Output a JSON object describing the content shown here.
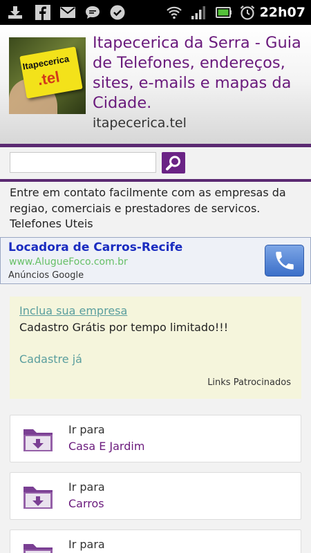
{
  "status_bar": {
    "time": "22h07",
    "icons": [
      "download-icon",
      "facebook-icon",
      "gmail-icon",
      "chat-icon",
      "check-badge-icon",
      "wifi-icon",
      "signal-icon",
      "battery-icon",
      "alarm-icon"
    ]
  },
  "header": {
    "logo_text_top": "Itapecerica",
    "logo_text_bottom": ".tel",
    "title": "Itapecerica da Serra - Guia de Telefones, endereços, sites, e-mails e mapas da Cidade.",
    "domain": "itapecerica.tel"
  },
  "search": {
    "value": "",
    "placeholder": ""
  },
  "intro": "Entre em contato facilmente com as empresas da regiao, comerciais e prestadores de servicos. Telefones Uteis",
  "ad": {
    "title": "Locadora de Carros-Recife",
    "url": "www.AlugueFoco.com.br",
    "label": "Anúncios Google"
  },
  "promo": {
    "link": "Inclua sua empresa",
    "text": "Cadastro Grátis por tempo limitado!!!",
    "cta": "Cadastre já",
    "note": "Links Patrocinados"
  },
  "categories": [
    {
      "prefix": "Ir para",
      "name": "Casa E Jardim"
    },
    {
      "prefix": "Ir para",
      "name": "Carros"
    },
    {
      "prefix": "Ir para",
      "name": ""
    }
  ],
  "colors": {
    "accent_purple": "#6a1a7c",
    "rule_purple": "#5b2a72",
    "ad_title_blue": "#1a2cc0",
    "ad_url_green": "#67c067",
    "promo_bg": "#f5f5dc",
    "promo_link": "#5a9e9e"
  }
}
